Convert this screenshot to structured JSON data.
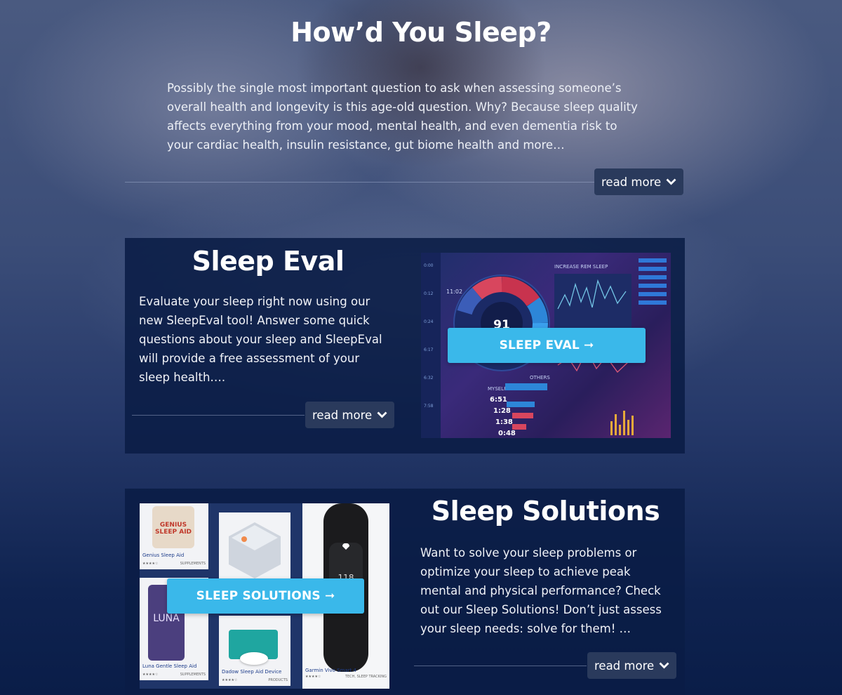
{
  "hero": {
    "title": "How’d You Sleep?",
    "text": "Possibly the single most important question to ask when assessing someone’s overall health and longevity is this age-old question. Why? Because sleep quality affects everything from your mood, mental health, and even dementia risk to your cardiac health, insulin resistance, gut biome health and more…",
    "read_more": "read more"
  },
  "sleep_eval": {
    "title": "Sleep Eval",
    "text": "Evaluate your sleep right now using our new SleepEval tool! Answer some quick questions about your sleep and SleepEval will provide a free assessment of your sleep health….",
    "read_more": "read more",
    "cta": "SLEEP EVAL ➞",
    "dashboard": {
      "score": "91",
      "time": "11:02",
      "rem_title": "INCREASE REM SLEEP",
      "myself": "MYSELF",
      "others": "OTHERS",
      "total": "6:51",
      "rem": "1:28",
      "deep": "1:38",
      "light": "0:48"
    }
  },
  "sleep_solutions": {
    "title": "Sleep Solutions",
    "text": "Want to solve your sleep problems or optimize your sleep to achieve peak mental and physical performance? Check out our Sleep Solutions! Don’t just assess your sleep needs: solve for them! …",
    "read_more": "read more",
    "cta": "SLEEP SOLUTIONS ➞",
    "products": [
      {
        "name": "Genius Sleep Aid",
        "tag": "SUPPLEMENTS",
        "brand": "GENIUS SLEEP AID"
      },
      {
        "name": "Luna Gentle Sleep Aid",
        "tag": "SUPPLEMENTS",
        "brand": "LUNA"
      },
      {
        "name": "Dadow Sleep Aid Device",
        "tag": "PRODUCTS"
      },
      {
        "name": "Garmin Vivo Smart 4",
        "tag": "TECH, SLEEP TRACKING",
        "screen": "118"
      }
    ]
  },
  "colors": {
    "cta": "#3ab8ea",
    "card_bg": "#0a1c46",
    "read_more_bg": "#2a3a5c"
  }
}
